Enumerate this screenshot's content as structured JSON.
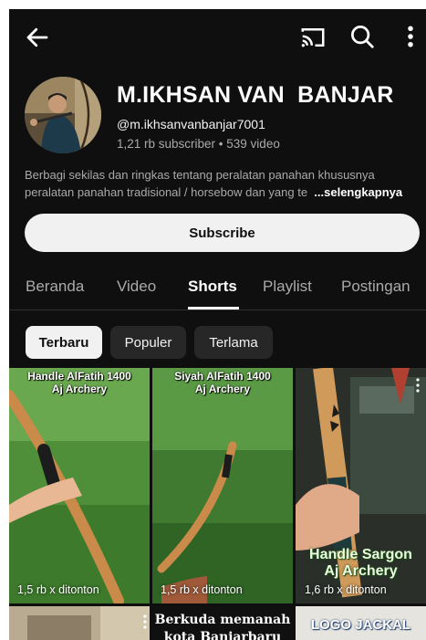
{
  "channel": {
    "name": "M.IKHSAN VAN  BANJAR",
    "handle": "@m.ikhsanvanbanjar7001",
    "stats": "1,21 rb subscriber • 539 video",
    "description_line1": "Berbagi sekilas dan ringkas  tentang  peralatan panahan khususnya",
    "description_line2": "peralatan panahan tradisional / horsebow dan yang te",
    "description_more": "...selengkapnya",
    "subscribe_label": "Subscribe"
  },
  "tabs": [
    "Beranda",
    "Video",
    "Shorts",
    "Playlist",
    "Postingan"
  ],
  "active_tab": "Shorts",
  "chips": [
    "Terbaru",
    "Populer",
    "Terlama"
  ],
  "selected_chip": "Terbaru",
  "shorts": [
    {
      "overlay": "Handle AlFatih 1400\nAj Archery",
      "views": "1,5 rb x ditonton"
    },
    {
      "overlay": "Siyah AlFatih 1400\nAj Archery",
      "views": "1,5 rb x ditonton"
    },
    {
      "overlay": "Handle Sargon\nAj Archery",
      "views": "1,6 rb x ditonton"
    }
  ],
  "shorts_row2": [
    {
      "overlay": ""
    },
    {
      "overlay": "Berkuda memanah\nkota Banjarbaru"
    },
    {
      "overlay": "LOGO JACKAL"
    }
  ],
  "icons": {
    "back": "arrow-left-icon",
    "cast": "cast-icon",
    "search": "search-icon",
    "more": "more-vert-icon"
  },
  "colors": {
    "background": "#0f0f0f",
    "text_secondary": "#aaaaaa",
    "button_light": "#f1f1f1",
    "chip_dark": "#272727"
  }
}
